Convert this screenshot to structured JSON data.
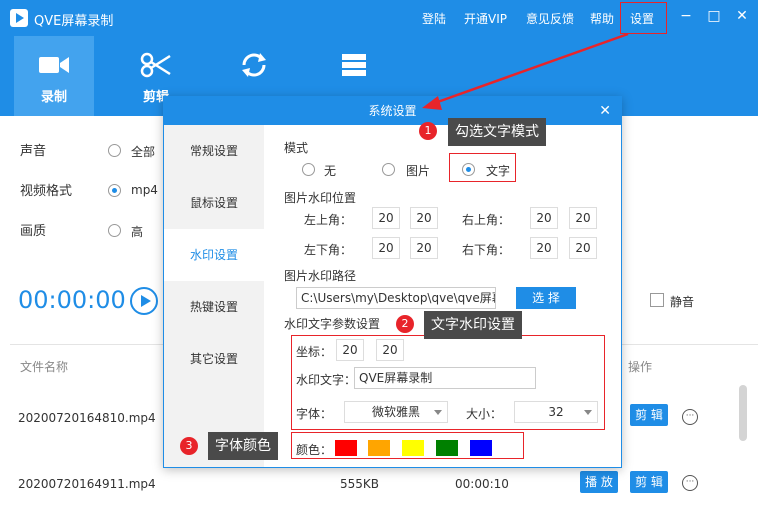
{
  "app": {
    "title": "QVE屏幕录制"
  },
  "menu": {
    "login": "登陆",
    "vip": "开通VIP",
    "feedback": "意见反馈",
    "help": "帮助",
    "settings": "设置"
  },
  "window_controls": {
    "minimize": "−",
    "maximize": "□",
    "close": "✕"
  },
  "toolbar": {
    "record": "录制",
    "edit": "剪辑",
    "convert_icon": "refresh-icon",
    "list_icon": "list-icon"
  },
  "main": {
    "audio_label": "声音",
    "audio_option": "全部",
    "format_label": "视频格式",
    "format_option": "mp4",
    "quality_label": "画质",
    "quality_option": "高",
    "timer": "00:00:00",
    "mute_label": "静音",
    "col_filename": "文件名称",
    "col_action": "操作",
    "files": [
      {
        "name": "20200720164810.mp4",
        "edit": "剪 辑"
      },
      {
        "name": "20200720164911.mp4",
        "size": "555KB",
        "duration": "00:00:10",
        "play": "播 放",
        "edit": "剪 辑"
      }
    ]
  },
  "dialog": {
    "title": "系统设置",
    "close": "✕",
    "side": [
      "常规设置",
      "鼠标设置",
      "水印设置",
      "热键设置",
      "其它设置"
    ],
    "mode_title": "模式",
    "modes": [
      "无",
      "图片",
      "文字"
    ],
    "img_pos_title": "图片水印位置",
    "top_left": "左上角：",
    "top_right": "右上角：",
    "bottom_left": "左下角：",
    "bottom_right": "右下角：",
    "tl_x": "20",
    "tl_y": "20",
    "tr_x": "20",
    "tr_y": "20",
    "bl_x": "20",
    "bl_y": "20",
    "br_x": "20",
    "br_y": "20",
    "img_path_title": "图片水印路径",
    "img_path": "C:\\Users\\my\\Desktop\\qve\\qve屏幕",
    "choose_btn": "选 择",
    "text_params_title": "水印文字参数设置",
    "coord_label": "坐标：",
    "coord_x": "20",
    "coord_y": "20",
    "wm_text_label": "水印文字：",
    "wm_text": "QVE屏幕录制",
    "font_label": "字体：",
    "font_value": "微软雅黑",
    "size_label": "大小：",
    "size_value": "32",
    "color_label": "颜色：",
    "colors": [
      "#ff0000",
      "#ffa500",
      "#ffff00",
      "#008000",
      "#0000ff"
    ]
  },
  "annotations": [
    {
      "num": "1",
      "text": "勾选文字模式"
    },
    {
      "num": "2",
      "text": "文字水印设置"
    },
    {
      "num": "3",
      "text": "字体颜色"
    }
  ]
}
